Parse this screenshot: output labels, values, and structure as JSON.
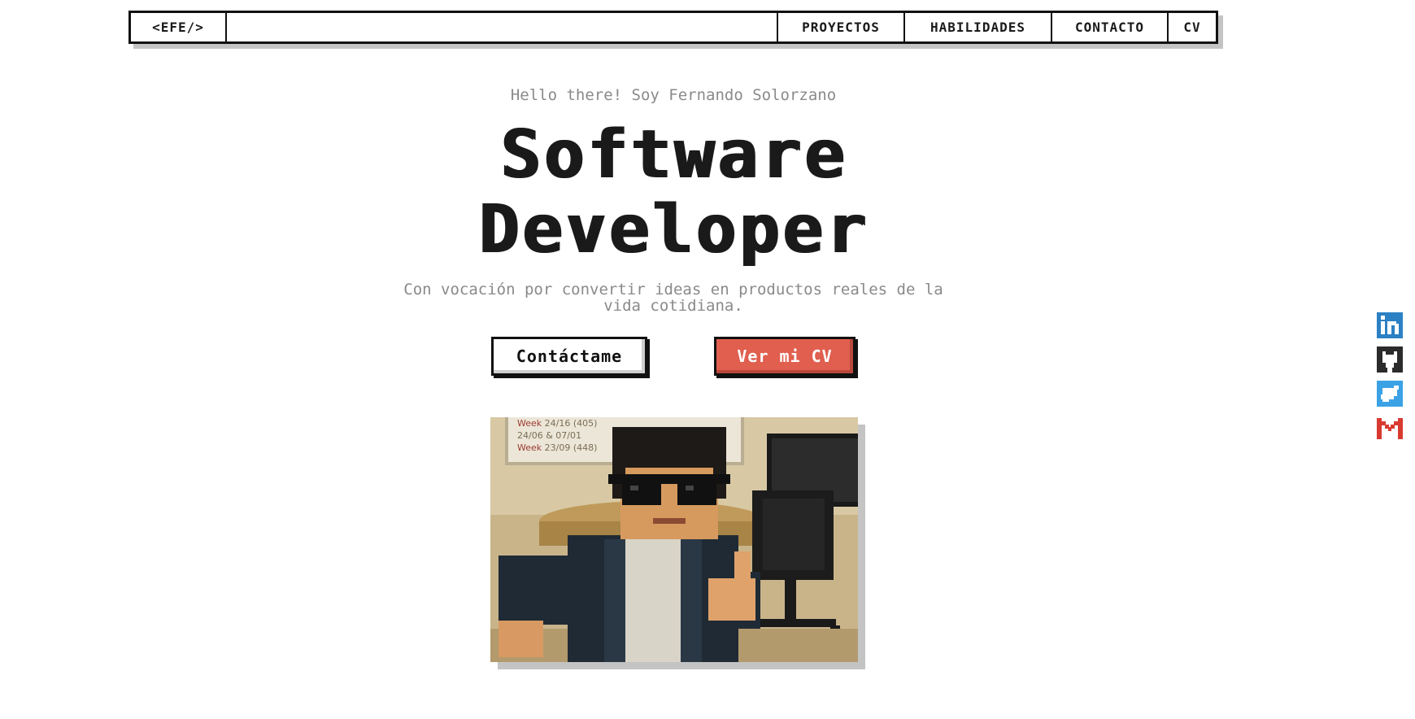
{
  "nav": {
    "logo": "<EFE/>",
    "items": [
      {
        "label": "PROYECTOS"
      },
      {
        "label": "HABILIDADES"
      },
      {
        "label": "CONTACTO"
      },
      {
        "label": "CV"
      }
    ]
  },
  "hero": {
    "greeting": "Hello there! Soy Fernando Solorzano",
    "title_line1": "Software",
    "title_line2": "Developer",
    "subtitle": "Con vocación por convertir ideas en productos reales de la vida cotidiana.",
    "contact_button": "Contáctame",
    "cv_button": "Ver mi CV"
  },
  "photo": {
    "board_lines": [
      {
        "label": "Week",
        "value": "24/16",
        "note": "(405)"
      },
      {
        "label": "",
        "value": "24/06 & 07/01",
        "note": ""
      },
      {
        "label": "Week",
        "value": "23/09",
        "note": "(448)"
      }
    ]
  },
  "social": [
    "linkedin-icon",
    "github-icon",
    "twitter-icon",
    "gmail-icon"
  ],
  "colors": {
    "accent": "#e05f4f",
    "text": "#1a1a1a",
    "muted": "#8a8a8a",
    "shadow": "#c4c4c4"
  }
}
